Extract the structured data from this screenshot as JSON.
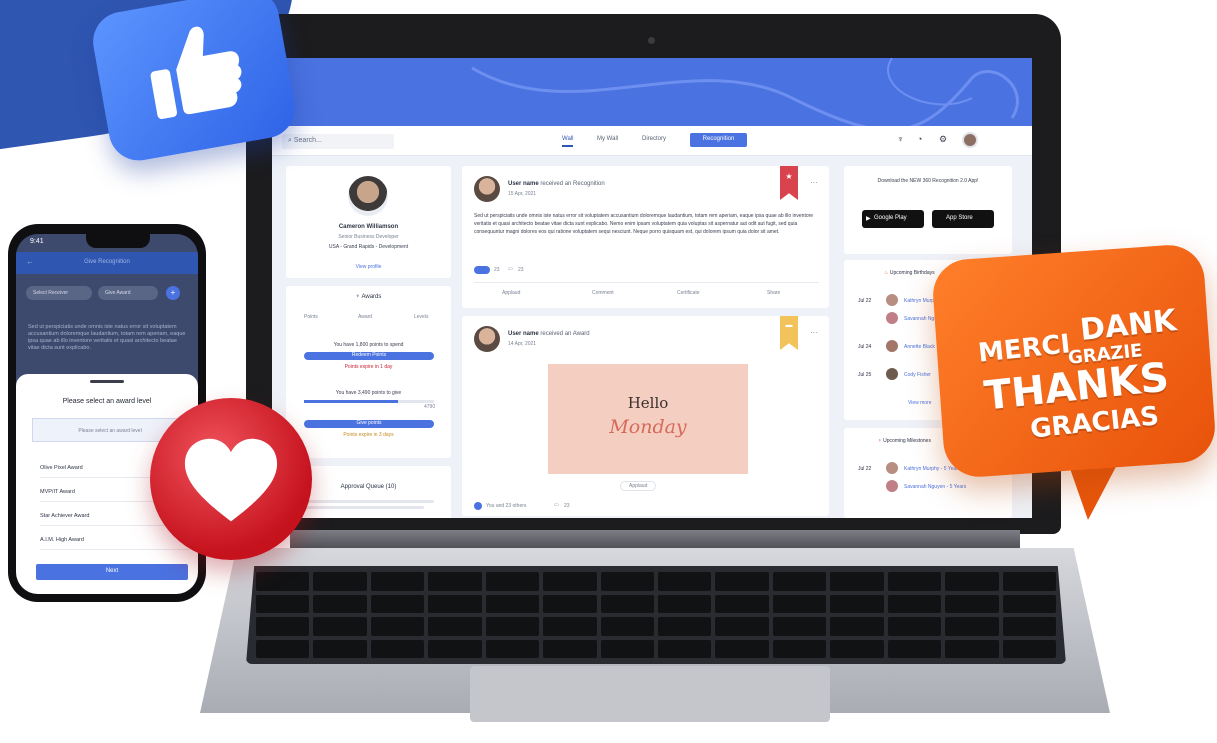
{
  "app": {
    "search_placeholder": "Search...",
    "nav": [
      "Wall",
      "My Wall",
      "Directory",
      "Recognition"
    ]
  },
  "profile": {
    "name": "Cameron Williamson",
    "title": "Senior Business Developer",
    "location": "USA - Grand Rapids - Development",
    "link": "View profile"
  },
  "awards": {
    "title": "Awards",
    "tabs": [
      "Points",
      "Award",
      "Levels"
    ],
    "points_text": "You have 1,800 points to spend",
    "redeem_button": "Redeem Points",
    "expire_1": "Points expire in 1 day",
    "give_text": "You have 3,490 points to give",
    "give_total": "4790",
    "give_button": "Give points",
    "expire_2": "Points expire in 3 days"
  },
  "queue": {
    "title": "Approval Queue (10)"
  },
  "posts": [
    {
      "user": "User name",
      "action": "received an Recognition",
      "date": "15 Apr, 2021",
      "body": "Sed ut perspiciatis unde omnis iste natus error sit voluptatem accusantium doloremque laudantium, totam rem aperiam, eaque ipsa quae ab illo inventore veritatis et quasi architecto beatae vitae dicta sunt explicabo. Nemo enim ipsam voluptatem quia voluptas sit aspernatur aut odit aut fugit, sed quia consequuntur magni dolores eos qui ratione voluptatem sequi nesciunt. Neque porro quisquam est, qui dolorem ipsum quia dolor sit amet.",
      "reactions": "23",
      "comments": "23",
      "actions": [
        "Applaud",
        "Comment",
        "Certificate",
        "Share"
      ]
    },
    {
      "user": "User name",
      "action": "received an Award",
      "date": "14 Apr, 2021",
      "image_title": "Hello",
      "image_subtitle": "Monday",
      "applaud": "Applaud",
      "footer": "You and 23 others",
      "comments": "23"
    }
  ],
  "sidebar_right": {
    "download_text": "Download the NEW 360 Recognition 2.0 App!",
    "google_play": "Google Play",
    "app_store": "App Store",
    "birthdays_title": "Upcoming Birthdays",
    "birthdays": [
      {
        "date": "Jul 22",
        "name": "Kathryn Murphy"
      },
      {
        "date": "",
        "name": "Savannah Nguyen"
      },
      {
        "date": "Jul 24",
        "name": "Annette Black"
      },
      {
        "date": "Jul 25",
        "name": "Cody Fisher"
      }
    ],
    "view_more": "View more",
    "milestones_title": "Upcoming Milestones",
    "milestones": [
      {
        "date": "Jul 22",
        "name": "Kathryn Murphy - 5 Years"
      },
      {
        "date": "",
        "name": "Savannah Nguyen - 5 Years"
      }
    ]
  },
  "phone": {
    "time": "9:41",
    "header": "Give Recognition",
    "chip_1": "Select Receiver",
    "chip_2": "Give Award",
    "body": "Sed ut perspiciatis unde omnis iste natus error sit voluptatem accusantium doloremque laudantium, totam rem aperiam, eaque ipsa quae ab illo inventore veritatis et quasi architecto beatae vitae dicta sunt explicabo.",
    "sheet_title": "Please select an award level",
    "select_placeholder": "Please select an award level",
    "options": [
      "Olive Pixel Award",
      "MVP/IT Award",
      "Star Achiever Award",
      "A.I.M. High Award"
    ],
    "next_button": "Next"
  },
  "stickers": {
    "words": [
      "DANK",
      "MERCI",
      "GRAZIE",
      "THANKS",
      "GRACIAS"
    ]
  },
  "colors": {
    "brand_blue": "#4a72e0",
    "sticker_orange": "#f26a1b",
    "heart_red": "#d81f2a",
    "like_blue": "#3a74f2"
  }
}
